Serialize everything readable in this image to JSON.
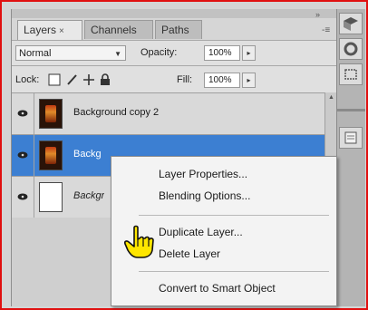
{
  "panel": {
    "tabs": [
      {
        "label": "Layers",
        "close": "×"
      },
      {
        "label": "Channels"
      },
      {
        "label": "Paths"
      }
    ],
    "collapse_glyph": "»",
    "menu_glyph": "-≡"
  },
  "options": {
    "blend_mode": "Normal",
    "opacity_label": "Opacity:",
    "opacity_value": "100%",
    "lock_label": "Lock:",
    "fill_label": "Fill:",
    "fill_value": "100%"
  },
  "layers": [
    {
      "name": "Background copy 2",
      "thumbnail": "photo",
      "selected": false
    },
    {
      "name": "Backg",
      "thumbnail": "photo",
      "selected": true
    },
    {
      "name": "Backgr",
      "thumbnail": "blank",
      "selected": false
    }
  ],
  "context_menu": {
    "items": [
      "Layer Properties...",
      "Blending Options...",
      "Duplicate Layer...",
      "Delete Layer",
      "Convert to Smart Object"
    ]
  },
  "colors": {
    "selection": "#3c7fd2",
    "frame": "#e01010",
    "cursor": "#ffe600"
  },
  "icons": {
    "tab_close": "close-icon",
    "blend_dropdown": "chevron-down-icon",
    "visibility": "eye-icon",
    "lock_transparent": "checkerboard-lock-icon",
    "lock_image": "brush-lock-icon",
    "lock_position": "move-lock-icon",
    "lock_all": "padlock-icon",
    "cursor": "hand-pointer-icon"
  }
}
